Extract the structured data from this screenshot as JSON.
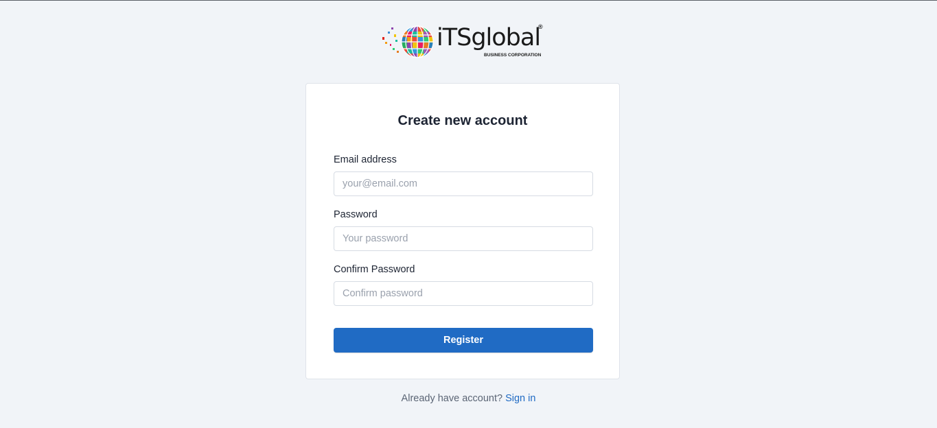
{
  "brand": {
    "wordmark": "iTSglobal",
    "registered": "®",
    "tagline": "BUSINESS CORPORATION",
    "icon": "globe-logo-icon"
  },
  "card": {
    "title": "Create new account"
  },
  "form": {
    "email": {
      "label": "Email address",
      "placeholder": "your@email.com",
      "value": ""
    },
    "password": {
      "label": "Password",
      "placeholder": "Your password",
      "value": ""
    },
    "confirm_password": {
      "label": "Confirm Password",
      "placeholder": "Confirm password",
      "value": ""
    },
    "submit_label": "Register"
  },
  "footer": {
    "prompt": "Already have account?",
    "link_label": "Sign in"
  },
  "colors": {
    "background": "#f1f4f8",
    "primary": "#206bc4",
    "text": "#1d2433",
    "muted": "#5b6575"
  }
}
